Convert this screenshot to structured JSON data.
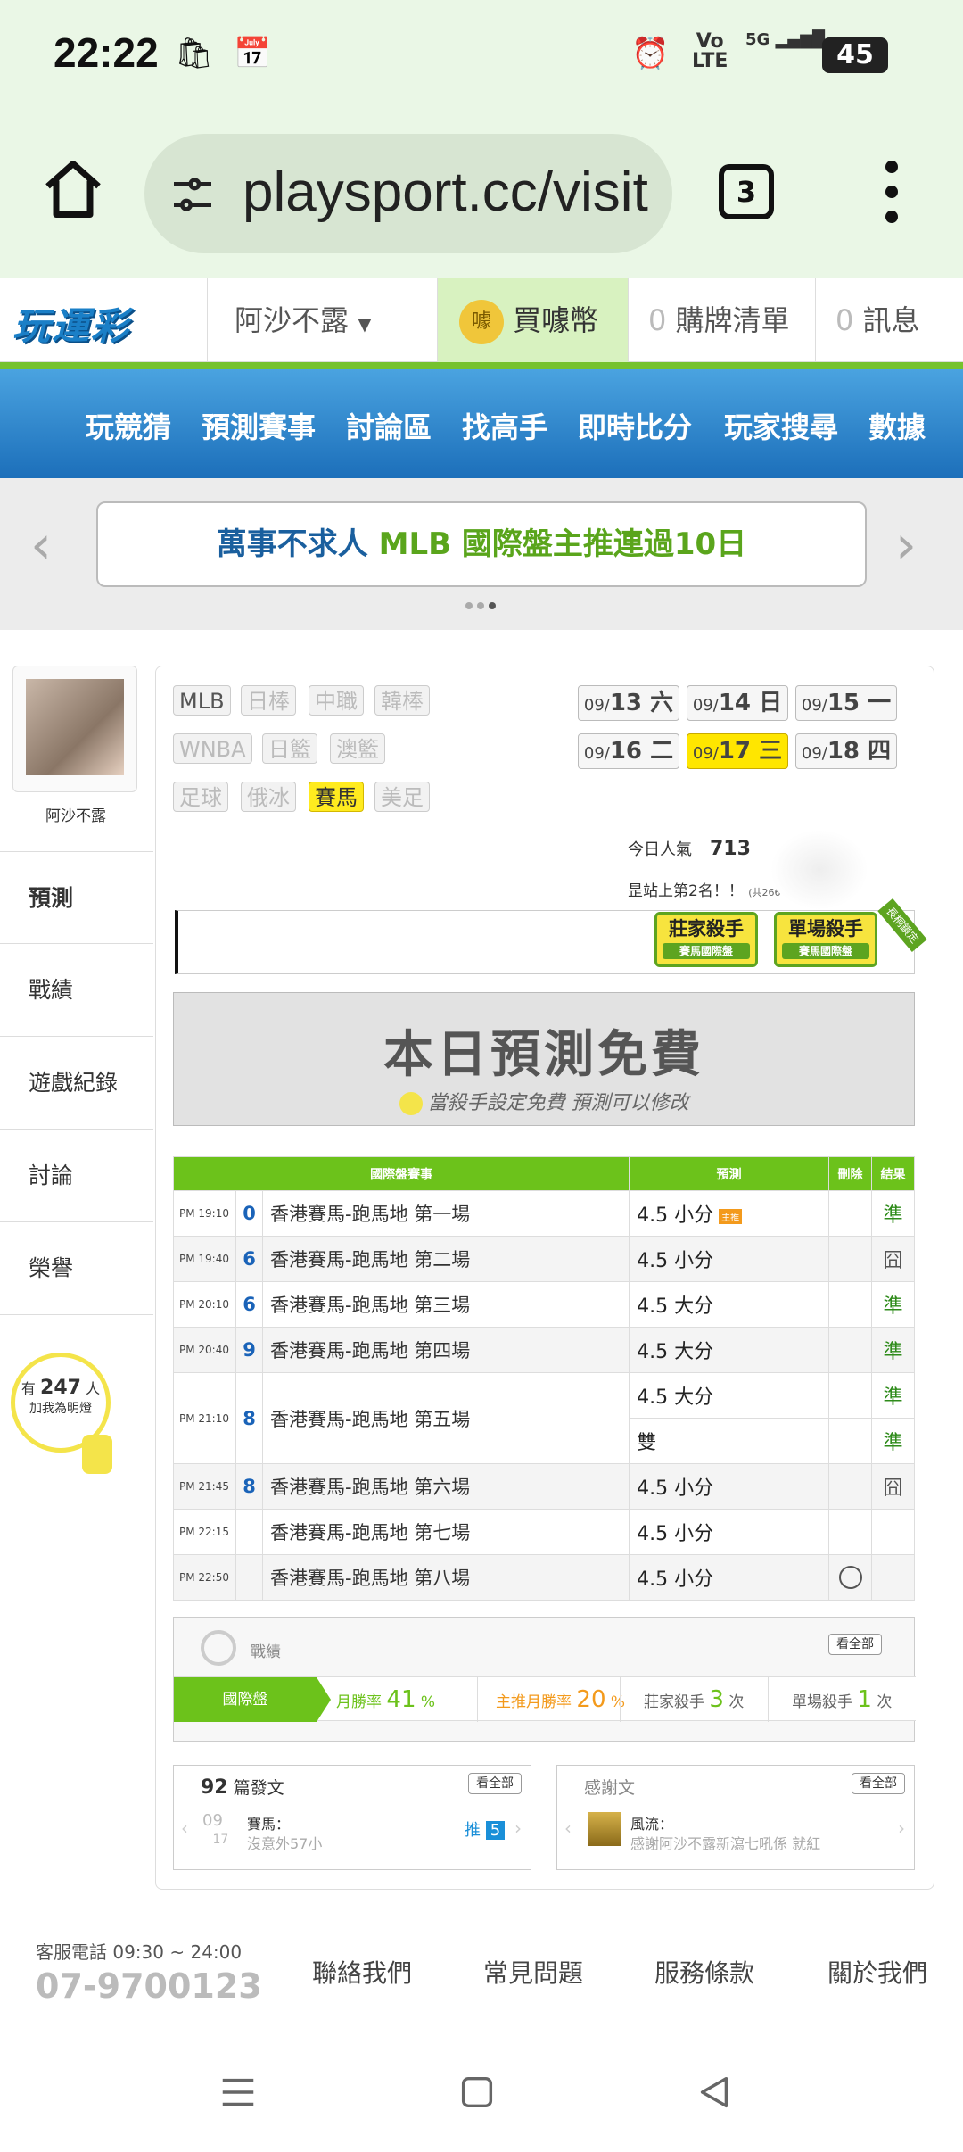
{
  "status": {
    "time": "22:22",
    "battery": "45",
    "net1": "Vo",
    "net2": "LTE",
    "sig": "5G"
  },
  "browser": {
    "url": "playsport.cc/visit",
    "tab_count": "3"
  },
  "site": {
    "logo": "玩運彩",
    "user_menu": "阿沙不露",
    "coin_label": "買噱幣",
    "coin_badge": "噱",
    "cart_count": "0",
    "cart_label": "購牌清單",
    "msg_count": "0",
    "msg_label": "訊息"
  },
  "nav": [
    "玩競猜",
    "預測賽事",
    "討論區",
    "找高手",
    "即時比分",
    "玩家搜尋",
    "數據"
  ],
  "banner": {
    "part1": "萬事不求人 ",
    "part2": "MLB 國際盤主推連過10日"
  },
  "profile": {
    "name": "阿沙不露"
  },
  "side_menu": [
    "預測",
    "戰績",
    "遊戲紀錄",
    "討論",
    "榮譽"
  ],
  "bulb": {
    "pre": "有",
    "count": "247",
    "post": "人",
    "sub": "加我為明燈"
  },
  "leagues": [
    "MLB",
    "日棒",
    "中職",
    "韓棒",
    "WNBA",
    "日籃",
    "澳籃",
    "足球",
    "俄冰",
    "賽馬",
    "美足"
  ],
  "dates": [
    {
      "md": "09/",
      "d": "13",
      "w": "六"
    },
    {
      "md": "09/",
      "d": "14",
      "w": "日"
    },
    {
      "md": "09/",
      "d": "15",
      "w": "一"
    },
    {
      "md": "09/",
      "d": "16",
      "w": "二"
    },
    {
      "md": "09/",
      "d": "17",
      "w": "三"
    },
    {
      "md": "09/",
      "d": "18",
      "w": "四"
    }
  ],
  "popularity": {
    "label": "今日人氣",
    "value": "713"
  },
  "rank": {
    "text": "昰站上第2名！！",
    "total": "(共2666人)"
  },
  "badges": [
    {
      "title": "莊家殺手",
      "sub": "賽馬國際盤"
    },
    {
      "title": "單場殺手",
      "sub": "賽馬國際盤"
    }
  ],
  "ribbon": "長桐鎖定",
  "free": {
    "title": "本日預測免費",
    "sub": "當殺手設定免費  預測可以修改"
  },
  "table": {
    "headers": [
      "國際盤賽事",
      "預測",
      "刪除",
      "結果"
    ],
    "tag": "主推",
    "rows": [
      {
        "time": "PM 19:10",
        "num": "0",
        "race": "香港賽馬-跑馬地 第一場",
        "pred": "4.5 小分",
        "result": "準"
      },
      {
        "time": "PM 19:40",
        "num": "6",
        "race": "香港賽馬-跑馬地 第二場",
        "pred": "4.5 小分",
        "result": "囧"
      },
      {
        "time": "PM 20:10",
        "num": "6",
        "race": "香港賽馬-跑馬地 第三場",
        "pred": "4.5 大分",
        "result": "準"
      },
      {
        "time": "PM 20:40",
        "num": "9",
        "race": "香港賽馬-跑馬地 第四場",
        "pred": "4.5 大分",
        "result": "準"
      },
      {
        "time": "PM 21:10",
        "num": "8",
        "race": "香港賽馬-跑馬地 第五場",
        "pred": "4.5 大分",
        "result": "準",
        "pred2": "雙",
        "result2": "準"
      },
      {
        "time": "PM 21:45",
        "num": "8",
        "race": "香港賽馬-跑馬地 第六場",
        "pred": "4.5 小分",
        "result": "囧"
      },
      {
        "time": "PM 22:15",
        "num": "",
        "race": "香港賽馬-跑馬地 第七場",
        "pred": "4.5 小分",
        "result": ""
      },
      {
        "time": "PM 22:50",
        "num": "",
        "race": "香港賽馬-跑馬地 第八場",
        "pred": "4.5 小分",
        "result": ""
      }
    ]
  },
  "record": {
    "title": "戰績",
    "see_all": "看全部",
    "tab": "國際盤",
    "month_rate_label": "月勝率",
    "month_rate": "41",
    "pct": "%",
    "main_rate_label": "主推月勝率",
    "main_rate": "20",
    "banker_label": "莊家殺手",
    "banker": "3",
    "times": "次",
    "single_label": "單場殺手",
    "single": "1"
  },
  "posts": {
    "count": "92",
    "count_label": "篇發文",
    "see_all": "看全部",
    "date_m": "09",
    "date_d": "17",
    "cat": "賽馬：",
    "text": "沒意外57小",
    "push_label": "推",
    "push": "5"
  },
  "thanks": {
    "title": "感謝文",
    "see_all": "看全部",
    "author": "風流：",
    "text": "感謝阿沙不露新瀉七吼係 就紅"
  },
  "footer": {
    "hours": "客服電話 09:30 ~ 24:00",
    "phone": "07-9700123",
    "links": [
      "聯絡我們",
      "常見問題",
      "服務條款",
      "關於我們"
    ]
  },
  "colors": {
    "accent_green": "#6cc21b",
    "nav_blue": "#1c6fba",
    "highlight_yellow": "#ffe600"
  }
}
